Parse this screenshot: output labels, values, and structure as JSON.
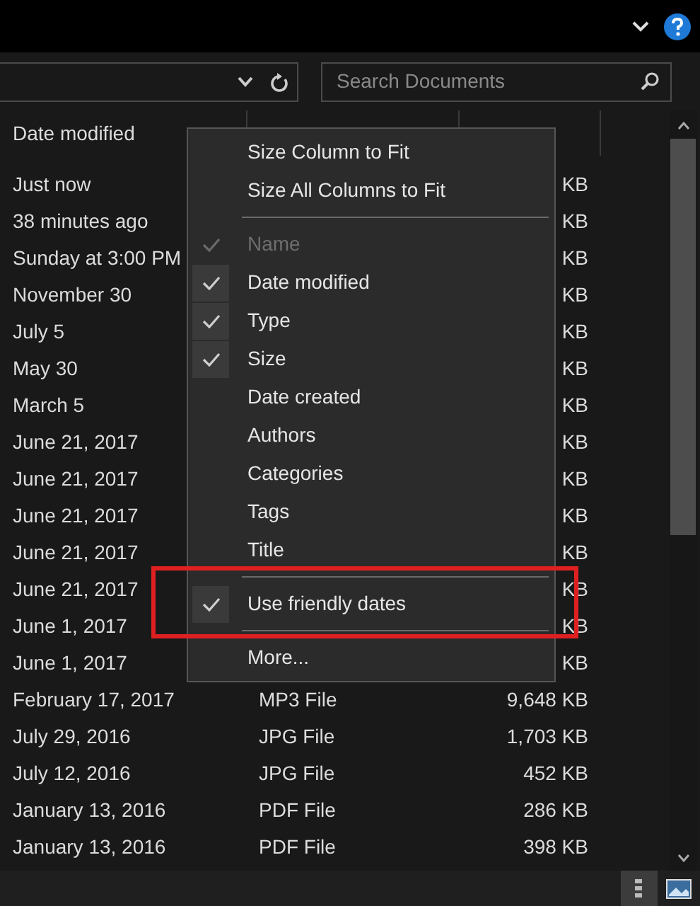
{
  "search": {
    "placeholder": "Search Documents"
  },
  "columns": [
    {
      "label": "Date modified"
    }
  ],
  "rows": [
    {
      "date": "Just now",
      "size": "KB"
    },
    {
      "date": "38 minutes ago",
      "size": "KB"
    },
    {
      "date": "Sunday at 3:00 PM",
      "size": "KB"
    },
    {
      "date": "November 30",
      "size": "KB"
    },
    {
      "date": "July 5",
      "size": "KB"
    },
    {
      "date": "May 30",
      "size": "KB"
    },
    {
      "date": "March 5",
      "size": "KB"
    },
    {
      "date": "June 21, 2017",
      "size": "KB"
    },
    {
      "date": "June 21, 2017",
      "size": "KB"
    },
    {
      "date": "June 21, 2017",
      "size": "KB"
    },
    {
      "date": "June 21, 2017",
      "size": "KB"
    },
    {
      "date": "June 21, 2017",
      "size": "KB"
    },
    {
      "date": "June 1, 2017",
      "size": "KB"
    },
    {
      "date": "June 1, 2017",
      "size": "KB"
    },
    {
      "date": "February 17, 2017",
      "type": "MP3 File",
      "size": "9,648 KB"
    },
    {
      "date": "July 29, 2016",
      "type": "JPG File",
      "size": "1,703 KB"
    },
    {
      "date": "July 12, 2016",
      "type": "JPG File",
      "size": "452 KB"
    },
    {
      "date": "January 13, 2016",
      "type": "PDF File",
      "size": "286 KB"
    },
    {
      "date": "January 13, 2016",
      "type": "PDF File",
      "size": "398 KB"
    }
  ],
  "context_menu": {
    "items": [
      {
        "kind": "command",
        "label": "Size Column to Fit"
      },
      {
        "kind": "command",
        "label": "Size All Columns to Fit"
      },
      {
        "kind": "separator"
      },
      {
        "kind": "toggle",
        "label": "Name",
        "checked": true,
        "disabled": true
      },
      {
        "kind": "toggle",
        "label": "Date modified",
        "checked": true,
        "disabled": false
      },
      {
        "kind": "toggle",
        "label": "Type",
        "checked": true,
        "disabled": false
      },
      {
        "kind": "toggle",
        "label": "Size",
        "checked": true,
        "disabled": false
      },
      {
        "kind": "toggle",
        "label": "Date created",
        "checked": false,
        "disabled": false
      },
      {
        "kind": "toggle",
        "label": "Authors",
        "checked": false,
        "disabled": false
      },
      {
        "kind": "toggle",
        "label": "Categories",
        "checked": false,
        "disabled": false
      },
      {
        "kind": "toggle",
        "label": "Tags",
        "checked": false,
        "disabled": false
      },
      {
        "kind": "toggle",
        "label": "Title",
        "checked": false,
        "disabled": false
      },
      {
        "kind": "separator"
      },
      {
        "kind": "toggle",
        "label": "Use friendly dates",
        "checked": true,
        "disabled": false,
        "annotated": true
      },
      {
        "kind": "separator"
      },
      {
        "kind": "command",
        "label": "More..."
      }
    ]
  }
}
